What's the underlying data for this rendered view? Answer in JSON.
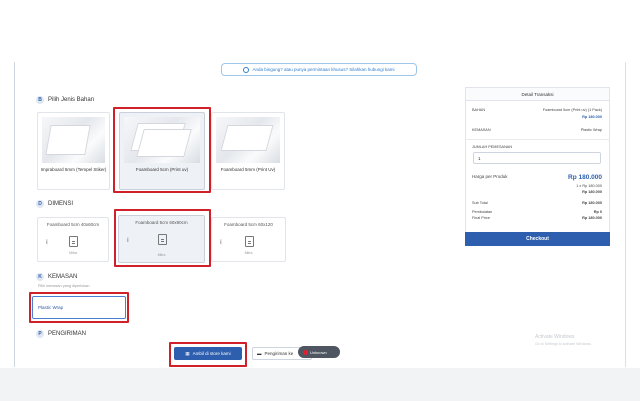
{
  "notice": {
    "text": "Anda bingung? atau punya permintaan khusus? Silahkan hubungi kami"
  },
  "sections": {
    "bahan": {
      "num": "B",
      "title": "Pilih Jenis Bahan"
    },
    "dimensi": {
      "num": "D",
      "title": "DIMENSI"
    },
    "kemasan": {
      "num": "K",
      "title": "KEMASAN",
      "hint": "Pilih kemasan yang diperlukan"
    },
    "pengiriman": {
      "num": "P",
      "title": "PENGIRIMAN"
    }
  },
  "materials": [
    {
      "label": "Impraboard 5mm (Tempel Stiker)"
    },
    {
      "label": "Foamboard 5cm (Print uv)"
    },
    {
      "label": "Foamboard 5mm (Print Uv)"
    }
  ],
  "dimensions": [
    {
      "label": "Foamboard 5cm 40x60cm",
      "sub": "Mitra"
    },
    {
      "label": "Foamboard 5cm 60x90cm",
      "sub": "Mitra"
    },
    {
      "label": "Foamboard 5cm 60x120",
      "sub": "Mitra"
    }
  ],
  "kemasan_option": "Plastic Wrap",
  "shipping": {
    "store_label": "Ambil di store kami",
    "ship_label": "Pengiriman ke",
    "pill": "Unknown"
  },
  "panel": {
    "title": "Detail Transaksi",
    "bahan_label": "BAHAN",
    "bahan_value": "Foamboard 5cm (Print uv) (1 Pack)",
    "bahan_price": "Rp 180.000",
    "kemasan_label": "KEMASAN",
    "kemasan_value": "Plastic Wrap",
    "jumlah_label": "JUMLAH PEMESANAN",
    "jumlah_value": "1",
    "harga_label": "Harga per Produk",
    "harga_value": "Rp 180.000",
    "calc_line": "1 x Rp 180.000",
    "calc_total": "Rp 180.000",
    "subtotal_label": "Sub Total",
    "subtotal_value": "Rp 180.000",
    "pembulatan_label": "Pembulatan",
    "pembulatan_value": "Rp 0",
    "final_label": "Final Price",
    "final_value": "Rp 180.000",
    "checkout": "Checkout"
  },
  "watermark": {
    "line1": "Activate Windows",
    "line2": "Go to Settings to activate Windows."
  }
}
